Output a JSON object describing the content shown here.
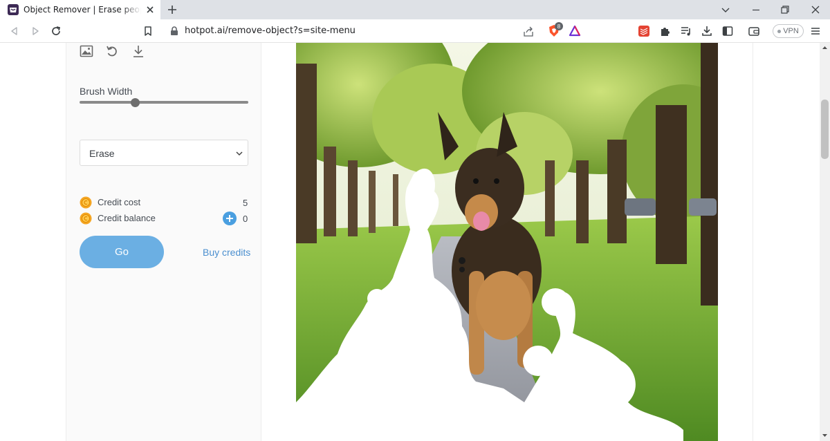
{
  "browser": {
    "tab_title": "Object Remover | Erase people an",
    "url": "hotpot.ai/remove-object?s=site-menu",
    "vpn_label": "VPN",
    "brave_badge": "8"
  },
  "toolbar": {
    "icons": [
      "image-icon",
      "undo-icon",
      "download-icon"
    ]
  },
  "brush": {
    "label": "Brush Width",
    "value_fraction": 0.33
  },
  "mode_select": {
    "value": "Erase"
  },
  "credits": {
    "cost_label": "Credit cost",
    "cost_value": "5",
    "balance_label": "Credit balance",
    "balance_value": "0"
  },
  "actions": {
    "go_label": "Go",
    "buy_label": "Buy credits"
  },
  "colors": {
    "accent": "#6bafe3",
    "link": "#4b8fcf",
    "coin": "#f5a623"
  }
}
